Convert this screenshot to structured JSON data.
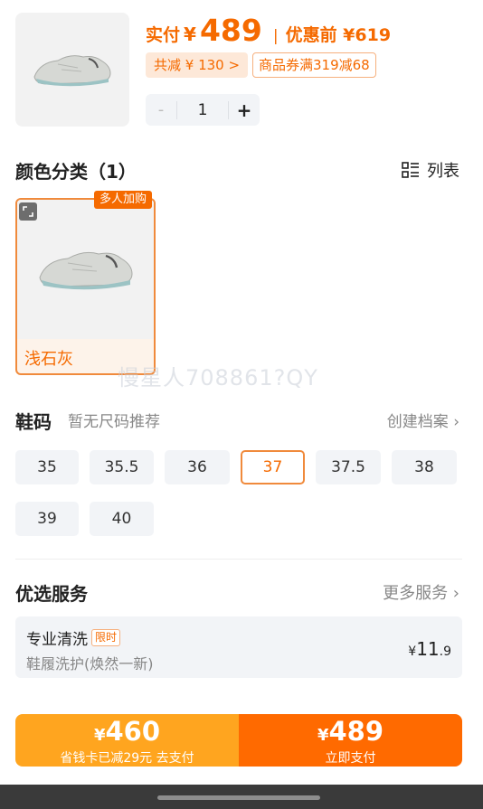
{
  "product": {
    "price_label": "实付",
    "currency": "¥",
    "price": "489",
    "pre_discount": "优惠前 ¥619",
    "total_discount": "共减 ¥ 130 >",
    "coupon": "商品券满319减68",
    "quantity": "1",
    "minus": "-",
    "plus": "+"
  },
  "color_section": {
    "title": "颜色分类（1）",
    "view_label": "列表",
    "badge": "多人加购",
    "items": [
      {
        "name": "浅石灰"
      }
    ]
  },
  "watermark": "慢星人708861?QY",
  "size_section": {
    "title": "鞋码",
    "hint": "暂无尺码推荐",
    "create_label": "创建档案 ›",
    "sizes": [
      "35",
      "35.5",
      "36",
      "37",
      "37.5",
      "38",
      "39",
      "40"
    ],
    "selected": "37"
  },
  "service_section": {
    "title": "优选服务",
    "more_label": "更多服务 ›",
    "item": {
      "name": "专业清洗",
      "tag": "限时",
      "desc": "鞋履洗护(焕然一新)",
      "price_currency": "¥",
      "price_int": "11",
      "price_dec": ".9"
    }
  },
  "pay": {
    "left_currency": "¥",
    "left_amount": "460",
    "left_sub": "省钱卡已减29元 去支付",
    "right_currency": "¥",
    "right_amount": "489",
    "right_sub": "立即支付"
  },
  "colors": {
    "accent": "#f56a00",
    "pay_left": "#ffa51f",
    "pay_right": "#ff6a00"
  }
}
